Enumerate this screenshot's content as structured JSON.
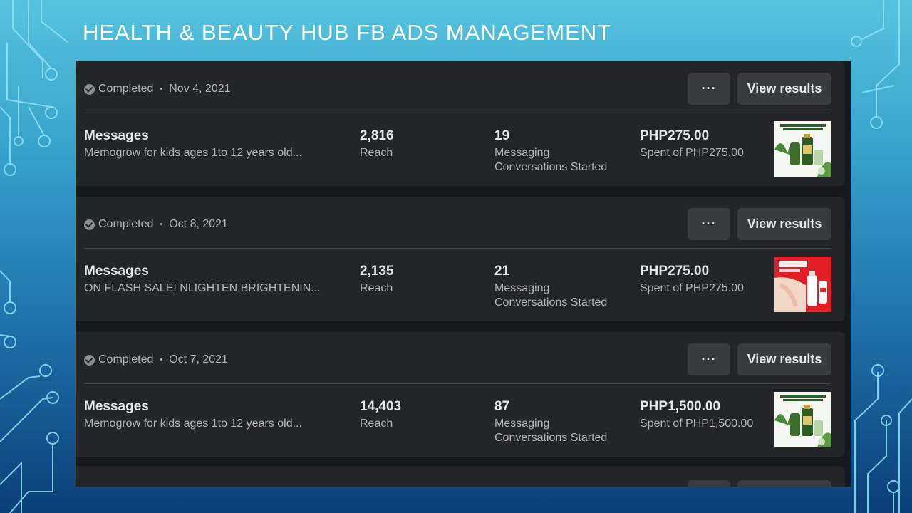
{
  "slide": {
    "title": "Health & Beauty Hub FB Ads Management"
  },
  "ads": [
    {
      "status": "Completed",
      "date": "Nov 4, 2021",
      "more_label": "···",
      "view_label": "View results",
      "objective": "Messages",
      "ad_name": "Memogrow for kids ages 1to 12 years old...",
      "reach": "2,816",
      "reach_label": "Reach",
      "conversations": "19",
      "conversations_label_1": "Messaging",
      "conversations_label_2": "Conversations Started",
      "amount": "PHP275.00",
      "spent": "Spent of PHP275.00",
      "thumbnail": "memogrow-product-image"
    },
    {
      "status": "Completed",
      "date": "Oct 8, 2021",
      "more_label": "···",
      "view_label": "View results",
      "objective": "Messages",
      "ad_name": "ON FLASH SALE! NLIGHTEN BRIGHTENIN...",
      "reach": "2,135",
      "reach_label": "Reach",
      "conversations": "21",
      "conversations_label_1": "Messaging",
      "conversations_label_2": "Conversations Started",
      "amount": "PHP275.00",
      "spent": "Spent of PHP275.00",
      "thumbnail": "flash-sale-product-image"
    },
    {
      "status": "Completed",
      "date": "Oct 7, 2021",
      "more_label": "···",
      "view_label": "View results",
      "objective": "Messages",
      "ad_name": "Memogrow for kids ages 1to 12 years old...",
      "reach": "14,403",
      "reach_label": "Reach",
      "conversations": "87",
      "conversations_label_1": "Messaging",
      "conversations_label_2": "Conversations Started",
      "amount": "PHP1,500.00",
      "spent": "Spent of PHP1,500.00",
      "thumbnail": "memogrow-product-image"
    }
  ],
  "colors": {
    "card": "#242526",
    "page": "#18191a",
    "button": "#3a3b3c",
    "text_primary": "#e4e6eb",
    "text_secondary": "#b0b3b8"
  }
}
